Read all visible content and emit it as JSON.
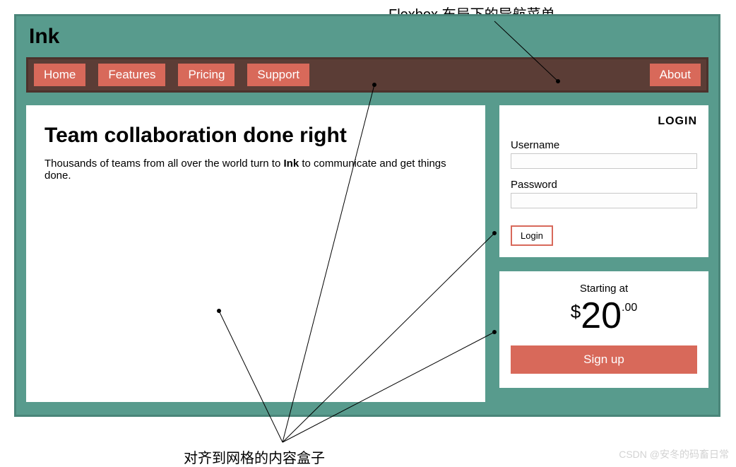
{
  "annotations": {
    "top": "Flexbox 布局下的导航菜单",
    "bottom": "对齐到网格的内容盒子",
    "watermark": "CSDN @安冬的码畜日常"
  },
  "logo": "Ink",
  "nav": {
    "items": [
      "Home",
      "Features",
      "Pricing",
      "Support"
    ],
    "right": "About"
  },
  "main": {
    "heading": "Team collaboration done right",
    "sub_pre": "Thousands of teams from all over the world turn to ",
    "sub_bold": "Ink",
    "sub_post": " to communicate and get things done."
  },
  "login": {
    "title": "LOGIN",
    "username_label": "Username",
    "password_label": "Password",
    "button": "Login"
  },
  "pricing": {
    "starting": "Starting at",
    "currency": "$",
    "amount": "20",
    "cents": ".00",
    "signup": "Sign up"
  }
}
